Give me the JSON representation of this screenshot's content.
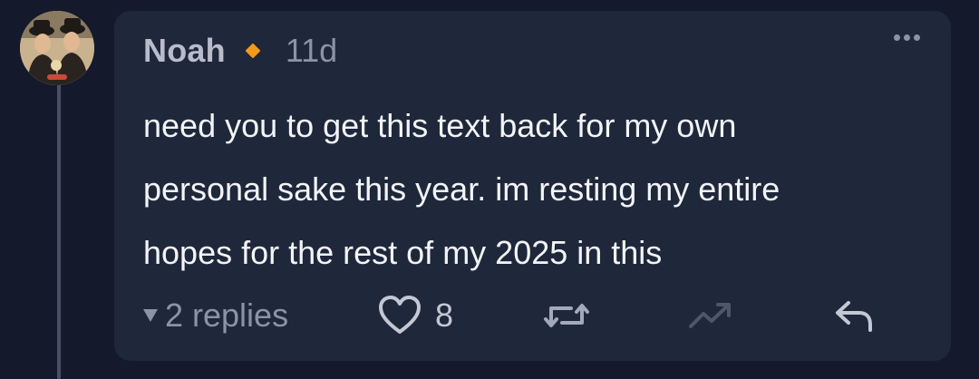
{
  "comment": {
    "author": "Noah",
    "time": "11d",
    "badge_color": "#f29a1b",
    "text_lines": [
      "need you to get this text back for my own",
      "personal sake this year. im resting my entire",
      "hopes for the rest of my 2025 in this"
    ],
    "replies_label": "2 replies",
    "like_count": "8"
  },
  "icons": {
    "more": "more-horizontal-icon",
    "like": "heart-icon",
    "repost": "repost-icon",
    "trend": "trending-up-icon",
    "reply": "reply-arrow-icon"
  }
}
